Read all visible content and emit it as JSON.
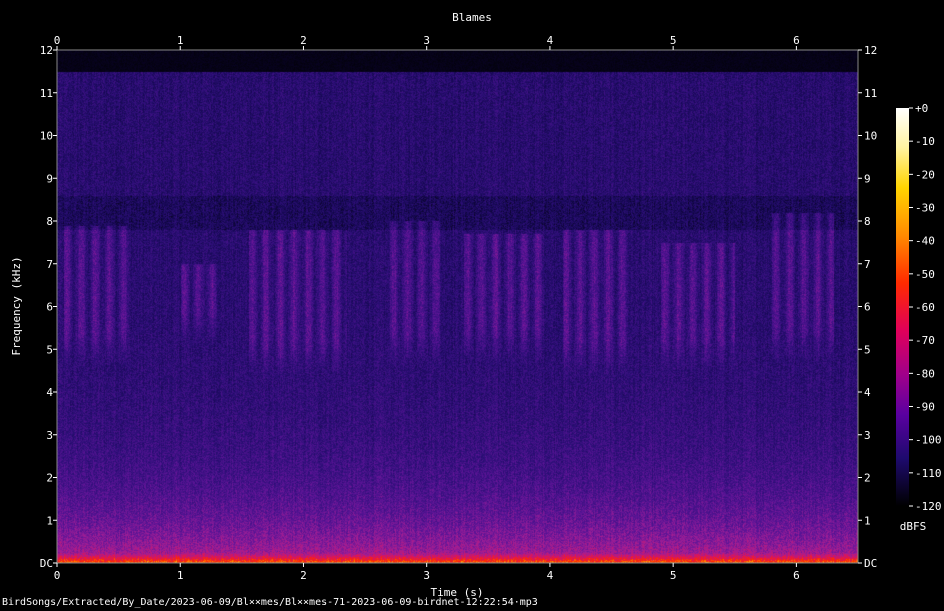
{
  "chart_data": {
    "type": "heatmap",
    "title": "Blames",
    "xlabel": "Time (s)",
    "ylabel": "Frequency (kHz)",
    "xlim": [
      0,
      6.5
    ],
    "ylim": [
      0,
      12
    ],
    "x_ticks": [
      "0",
      "1",
      "2",
      "3",
      "4",
      "5",
      "6"
    ],
    "y_ticks": [
      "DC",
      "1",
      "2",
      "3",
      "4",
      "5",
      "6",
      "7",
      "8",
      "9",
      "10",
      "11",
      "12"
    ],
    "colorbar": {
      "label": "dBFS",
      "range": [
        -120,
        0
      ],
      "ticks": [
        "+0",
        "-10",
        "-20",
        "-30",
        "-40",
        "-50",
        "-60",
        "-70",
        "-80",
        "-90",
        "-100",
        "-110",
        "-120"
      ],
      "colors": [
        "#ffffff",
        "#fff3a0",
        "#ffd400",
        "#ff8a00",
        "#ff2a00",
        "#e0005a",
        "#a0008a",
        "#5a00a0",
        "#1e0a6e",
        "#000000"
      ]
    },
    "bursts": [
      {
        "t0": 0.05,
        "t1": 0.6,
        "f_lo": 5.2,
        "f_hi": 7.9
      },
      {
        "t0": 1.0,
        "t1": 1.3,
        "f_lo": 5.7,
        "f_hi": 7.0
      },
      {
        "t0": 1.55,
        "t1": 2.35,
        "f_lo": 5.0,
        "f_hi": 7.8
      },
      {
        "t0": 2.7,
        "t1": 3.1,
        "f_lo": 5.2,
        "f_hi": 8.0
      },
      {
        "t0": 3.3,
        "t1": 3.95,
        "f_lo": 5.3,
        "f_hi": 7.7
      },
      {
        "t0": 4.1,
        "t1": 4.65,
        "f_lo": 5.0,
        "f_hi": 7.8
      },
      {
        "t0": 4.9,
        "t1": 5.5,
        "f_lo": 5.1,
        "f_hi": 7.5
      },
      {
        "t0": 5.8,
        "t1": 6.3,
        "f_lo": 5.3,
        "f_hi": 8.2
      }
    ]
  },
  "footer": "BirdSongs/Extracted/By_Date/2023-06-09/Bl××mes/Bl××mes-71-2023-06-09-birdnet-12:22:54·mp3"
}
